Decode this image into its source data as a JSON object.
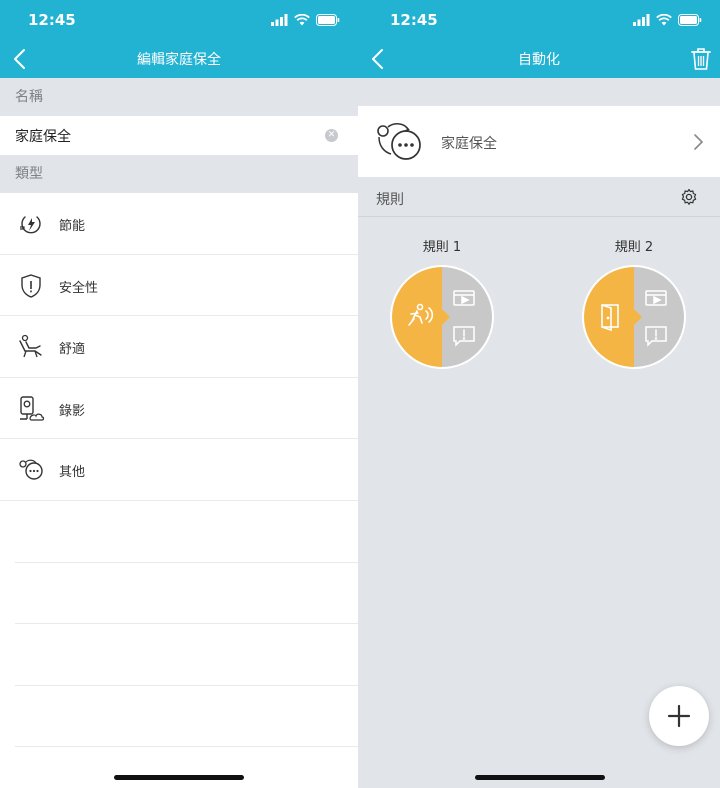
{
  "left_screen": {
    "status_time": "12:45",
    "nav_title": "編輯家庭保全",
    "name_section_label": "名稱",
    "name_value": "家庭保全",
    "type_section_label": "類型",
    "types": [
      {
        "label": "節能",
        "icon": "energy-saving-icon"
      },
      {
        "label": "安全性",
        "icon": "shield-icon"
      },
      {
        "label": "舒適",
        "icon": "recliner-icon"
      },
      {
        "label": "錄影",
        "icon": "camera-icon"
      },
      {
        "label": "其他",
        "icon": "other-icon"
      }
    ]
  },
  "right_screen": {
    "status_time": "12:45",
    "nav_title": "自動化",
    "home_label": "家庭保全",
    "rules_label": "規則",
    "rules": [
      {
        "name": "規則 1",
        "trigger_icon": "motion-icon",
        "action_icons": [
          "video-icon",
          "alert-icon"
        ]
      },
      {
        "name": "規則 2",
        "trigger_icon": "door-icon",
        "action_icons": [
          "video-icon",
          "alert-icon"
        ]
      }
    ]
  },
  "colors": {
    "header": "#22b2d2",
    "section_bg": "#e1e4e8",
    "trigger": "#f5b544",
    "action": "#c8c8c8"
  }
}
